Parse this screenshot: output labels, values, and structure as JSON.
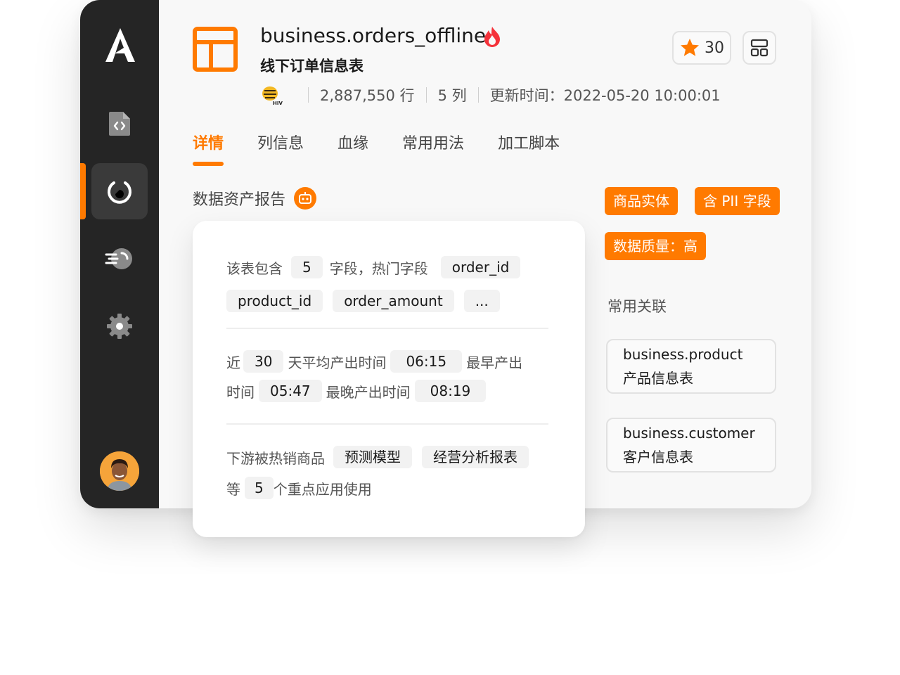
{
  "header": {
    "table_name": "business.orders_offline",
    "table_desc": "线下订单信息表",
    "rows": "2,887,550 行",
    "columns": "5 列",
    "updated": "更新时间：2022-05-20 10:00:01",
    "star_count": "30",
    "source_badge": "HIVE"
  },
  "tabs": [
    "详情",
    "列信息",
    "血缘",
    "常用用法",
    "加工脚本"
  ],
  "active_tab": "详情",
  "report": {
    "title": "数据资产报告",
    "line1_prefix": "该表包含",
    "field_count": "5",
    "line1_mid": "字段，热门字段",
    "hot_fields": [
      "order_id",
      "product_id",
      "order_amount",
      "..."
    ],
    "line3_prefix": "近",
    "days": "30",
    "line3_mid": "天平均产出时间",
    "avg_time": "06:15",
    "line3_tail": "最早产出",
    "line4_prefix": "时间",
    "earliest": "05:47",
    "line4_mid": "最晚产出时间",
    "latest": "08:19",
    "line5_prefix": "下游被热销商品",
    "app_1": "预测模型",
    "app_2": "经营分析报表",
    "line6_prefix": "等",
    "app_count": "5",
    "line6_suffix": "个重点应用使用"
  },
  "tags": [
    "商品实体",
    "含 PII 字段",
    "数据质量：高"
  ],
  "associations": {
    "title": "常用关联",
    "items": [
      {
        "name": "business.product",
        "desc": "产品信息表"
      },
      {
        "name": "business.customer",
        "desc": "客户信息表"
      }
    ]
  },
  "colors": {
    "accent": "#ff7a00",
    "sidebar": "#252525",
    "fire": "#f5323a"
  },
  "icons": {
    "sidebar": [
      "logo-icon",
      "code-file-icon",
      "refresh-circle-icon",
      "speed-icon",
      "gear-icon"
    ],
    "header": [
      "table-icon",
      "fire-icon",
      "star-icon",
      "layout-icon",
      "hive-icon"
    ],
    "report": "robot-icon"
  }
}
